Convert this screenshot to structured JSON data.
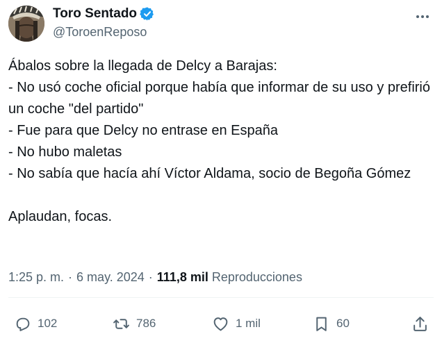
{
  "author": {
    "display_name": "Toro Sentado",
    "handle": "@ToroenReposo",
    "verified": true,
    "avatar_icon": "avatar-photo"
  },
  "tweet": {
    "lines": [
      "Ábalos sobre la llegada de Delcy a Barajas:",
      "- No usó coche oficial porque había que informar de su uso y prefirió un coche \"del partido\"",
      "- Fue para que Delcy no entrase en España",
      "- No hubo maletas",
      "- No sabía que hacía ahí Víctor Aldama, socio de Begoña Gómez"
    ],
    "closing": "Aplaudan, focas."
  },
  "meta": {
    "time": "1:25 p. m.",
    "separator": "·",
    "date": "6 may. 2024",
    "views_count": "111,8 mil",
    "views_label": "Reproducciones"
  },
  "actions": {
    "replies": "102",
    "retweets": "786",
    "likes": "1 mil",
    "bookmarks": "60"
  },
  "colors": {
    "verified": "#1d9bf0",
    "secondary_text": "#536471",
    "primary_text": "#0f1419"
  }
}
